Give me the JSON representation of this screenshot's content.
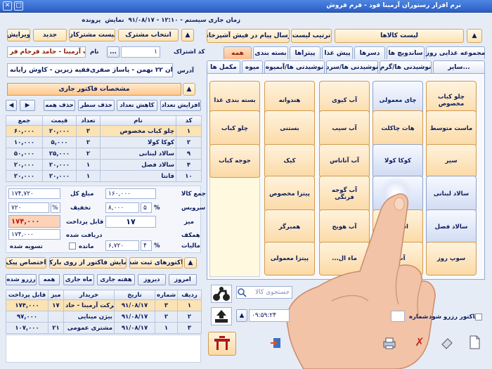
{
  "window": {
    "title": "نرم افزار رستوران آرمینا فود - فرم فروش"
  },
  "status": {
    "system_time": "زمان جاری سیستم - ۱۲:۱۰ - ۹۱/۰۸/۱۷",
    "show": "نمایش",
    "file": "پرونده"
  },
  "customer": {
    "btn_select_sub": "انتخاب مشترک",
    "btn_list": "لیست مشترکان",
    "btn_new": "جدید",
    "btn_edit": "ویرایش",
    "sub_code_label": "کد اشتراک",
    "sub_code": "۱",
    "name_label": "نام",
    "name": "شرکت آرمینا - حامد فرجام فر",
    "address_label": "آدرس",
    "address": "خیابان ۲۲ بهمن - پاساژ صفری‌فقیه زیرین - کاوش رایانه",
    "dots": "..."
  },
  "invoice": {
    "section_title": "مشخصات فاکتور جاری",
    "btn_increase": "افزایش تعداد",
    "btn_decrease": "کاهش تعداد",
    "btn_delete_row": "حذف سطر",
    "btn_delete_all": "حذف همه",
    "columns": [
      "کد",
      "نام",
      "تعداد",
      "قیمت",
      "جمع"
    ],
    "rows": [
      {
        "code": "۱",
        "name": "چلو کباب مخصوص",
        "qty": "۳",
        "price": "۲۰,۰۰۰",
        "total": "۶۰,۰۰۰"
      },
      {
        "code": "۲",
        "name": "کوکا کولا",
        "qty": "۲",
        "price": "۵,۰۰۰",
        "total": "۱۰,۰۰۰"
      },
      {
        "code": "۹",
        "name": "سالاد لبنانی",
        "qty": "۲",
        "price": "۲۵,۰۰۰",
        "total": "۵۰,۰۰۰"
      },
      {
        "code": "۴",
        "name": "سالاد فصل",
        "qty": "۱",
        "price": "۲۰,۰۰۰",
        "total": "۲۰,۰۰۰"
      },
      {
        "code": "۱۰",
        "name": "فانتا",
        "qty": "۱",
        "price": "۲۰,۰۰۰",
        "total": "۲۰,۰۰۰"
      }
    ]
  },
  "totals": {
    "sum_label": "جمع کالا",
    "sum": "۱۶۰,۰۰۰",
    "service_label": "سرویس",
    "service_pct": "۵",
    "service": "۸,۰۰۰",
    "table_label": "میز",
    "table": "۱۷",
    "waiter_label": "همکف",
    "tax_label": "مالیات",
    "tax_pct": "۴",
    "tax": "۶,۷۲۰",
    "grand_label": "مبلغ کل",
    "grand": "۱۷۴,۷۲۰",
    "discount_label": "تخفیف",
    "discount_pct": "%",
    "discount": "۷۲۰",
    "payable_label": "قابل پرداخت",
    "payable": "۱۷۴,۰۰۰",
    "received_label": "دریافت شده",
    "received": "۱۷۴,۰۰۰",
    "remain_label": "مانده",
    "settled_label": "تسویه شده",
    "pct_sign": "%"
  },
  "lower": {
    "btn_registered": "فاکتورهای ثبت شده",
    "btn_barcode": "نمایش فاکتور از روی بارکد",
    "btn_courier": "اختصاص پیک",
    "btn_today": "امروز",
    "btn_yesterday": "دیروز",
    "btn_week": "هفته جاری",
    "btn_month": "ماه جاری",
    "btn_all": "همه",
    "btn_reserve": "رزرو شده",
    "columns": [
      "ردیف",
      "شماره",
      "تاریخ",
      "خریدار",
      "میز",
      "قابل پرداخت"
    ],
    "rows": [
      {
        "row": "۱",
        "num": "۳",
        "date": "۹۱/۰۸/۱۷",
        "buyer": "شرکت آرمینا - حاد",
        "table": "۱۷",
        "pay": "۱۷۴,۰۰۰"
      },
      {
        "row": "۲",
        "num": "۲",
        "date": "۹۱/۰۸/۱۷",
        "buyer": "بیژن مینایی",
        "table": "",
        "pay": "۹۷,۰۰۰"
      },
      {
        "row": "۳",
        "num": "۱",
        "date": "۹۱/۰۸/۱۷",
        "buyer": "مشتری عمومی",
        "table": "۲۱",
        "pay": "۱۰۷,۰۰۰"
      }
    ]
  },
  "menu": {
    "btn_products": "لیست کالاها",
    "btn_order_list": "ترتیب لیست",
    "btn_send_kitchen": "ارسال پیام در فیش آشپزخانه",
    "tabs_row1": [
      "مجموعه غذایی روز",
      "ساندویچ ها",
      "دسرها",
      "پیش غذا",
      "پیتزاها",
      "بسته بندی",
      "همه"
    ],
    "tabs_row2": [
      "سایر...",
      "نوشیدنی ها/گرم",
      "نوشیدنی ها/سرد",
      "نوشیدنی ها/آبمیوه",
      "میوه",
      "مکمل ها"
    ],
    "tiles": [
      [
        "چلو کباب مخصوص",
        "چای معمولی",
        "آب کیوی",
        "هندوانه",
        "بسته بندی غذا"
      ],
      [
        "ماست متوسط",
        "هات چاکلت",
        "آب سیب",
        "بستنی",
        "چلو کباب"
      ],
      [
        "سیر",
        "کوکا کولا",
        "آب آناناس",
        "کیک",
        "جوجه کباب"
      ],
      [
        "سالاد لبنانی",
        "",
        "آب گوجه فرنگی",
        "پیتزا مخصوص",
        ""
      ],
      [
        "سالاد فصل",
        "اسپ...",
        "آب هویج",
        "همبرگر",
        ""
      ],
      [
        "سوپ روز",
        "آب...",
        "ماء ال...",
        "پیتزا معمولی",
        ""
      ]
    ],
    "search_placeholder": "جستجوی کالا",
    "time": "۰۹:۵۹:۲۴",
    "reserve_label": "فاکتور رزرو شود",
    "number_label": "شماره"
  }
}
